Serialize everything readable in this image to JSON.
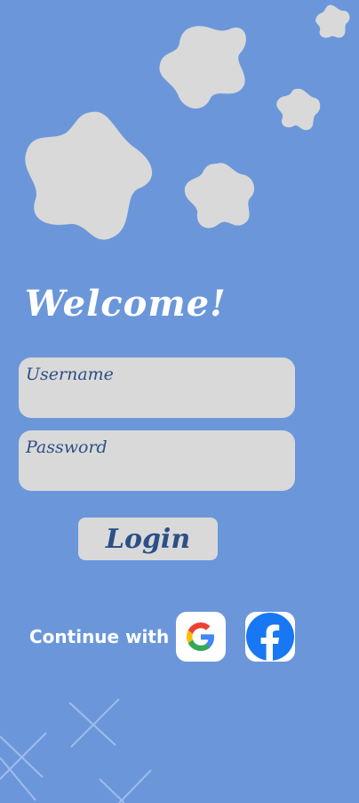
{
  "welcome_title": "Welcome!",
  "username_label": "Username",
  "password_label": "Password",
  "login_label": "Login",
  "continue_text": "Continue with",
  "colors": {
    "background": "#6b97da",
    "blob": "#d9d9d9",
    "accent_text": "#2b4f86",
    "facebook": "#1877f2"
  },
  "icons": [
    "google-icon",
    "facebook-icon"
  ]
}
